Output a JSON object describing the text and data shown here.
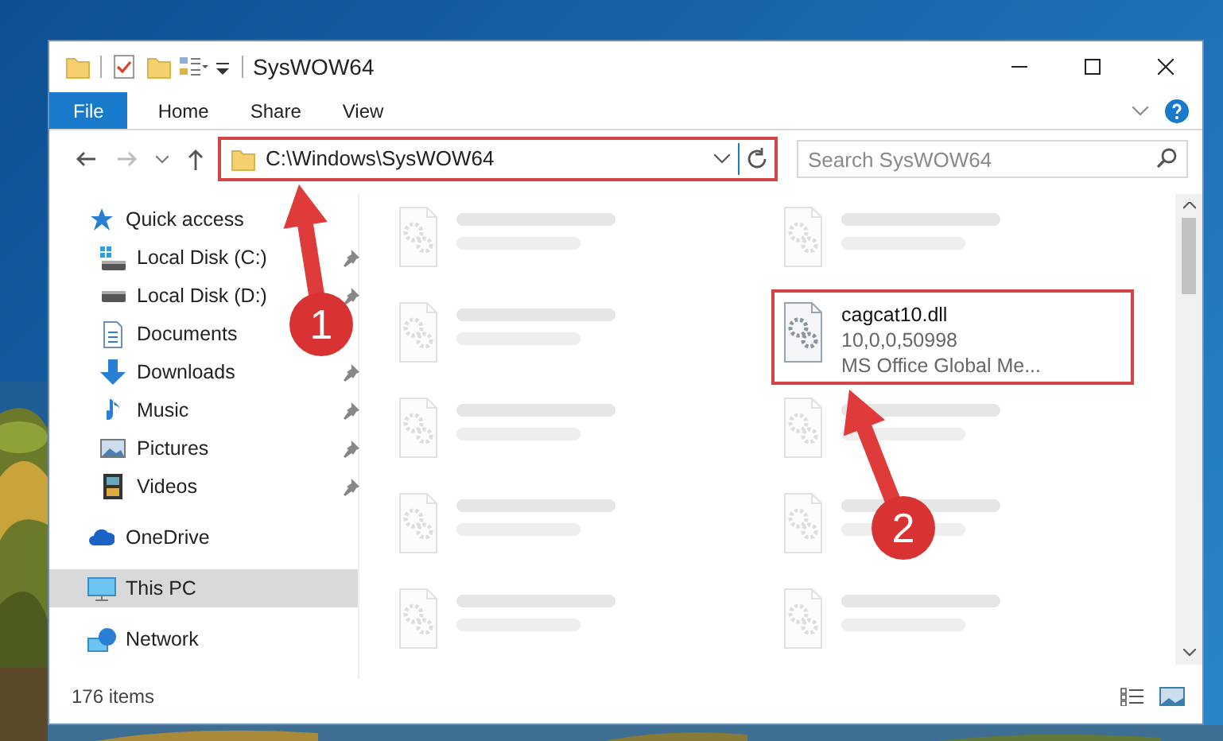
{
  "window": {
    "title": "SysWOW64"
  },
  "ribbon": {
    "tabs": [
      {
        "label": "File",
        "selected": true
      },
      {
        "label": "Home",
        "selected": false
      },
      {
        "label": "Share",
        "selected": false
      },
      {
        "label": "View",
        "selected": false
      }
    ]
  },
  "address_bar": {
    "path": "C:\\Windows\\SysWOW64",
    "highlighted": true
  },
  "search": {
    "placeholder": "Search SysWOW64"
  },
  "sidebar": {
    "items": [
      {
        "label": "Quick access",
        "kind": "star",
        "pinned": false,
        "selected": false,
        "children": [
          {
            "label": "Local Disk (C:)",
            "kind": "disk-win",
            "pinned": true,
            "selected": false
          },
          {
            "label": "Local Disk (D:)",
            "kind": "disk",
            "pinned": true,
            "selected": false
          },
          {
            "label": "Documents",
            "kind": "doc",
            "pinned": false,
            "selected": false
          },
          {
            "label": "Downloads",
            "kind": "download",
            "pinned": true,
            "selected": false
          },
          {
            "label": "Music",
            "kind": "music",
            "pinned": true,
            "selected": false
          },
          {
            "label": "Pictures",
            "kind": "pictures",
            "pinned": true,
            "selected": false
          },
          {
            "label": "Videos",
            "kind": "videos",
            "pinned": true,
            "selected": false
          }
        ]
      },
      {
        "label": "OneDrive",
        "kind": "cloud",
        "pinned": false,
        "selected": false
      },
      {
        "label": "This PC",
        "kind": "pc",
        "pinned": false,
        "selected": true
      },
      {
        "label": "Network",
        "kind": "network",
        "pinned": false,
        "selected": false
      }
    ]
  },
  "files": [
    {
      "blurred": true,
      "highlighted": false
    },
    {
      "blurred": true,
      "highlighted": false
    },
    {
      "blurred": true,
      "highlighted": false
    },
    {
      "name": "cagcat10.dll",
      "details": [
        "10,0,0,50998",
        "MS Office Global Me..."
      ],
      "blurred": false,
      "highlighted": true
    },
    {
      "blurred": true,
      "highlighted": false
    },
    {
      "blurred": true,
      "highlighted": false
    },
    {
      "blurred": true,
      "highlighted": false
    },
    {
      "blurred": true,
      "highlighted": false
    },
    {
      "blurred": true,
      "highlighted": false
    },
    {
      "blurred": true,
      "highlighted": false
    }
  ],
  "status_bar": {
    "item_count": "176 items"
  },
  "annotations": [
    {
      "number": "1"
    },
    {
      "number": "2"
    }
  ]
}
